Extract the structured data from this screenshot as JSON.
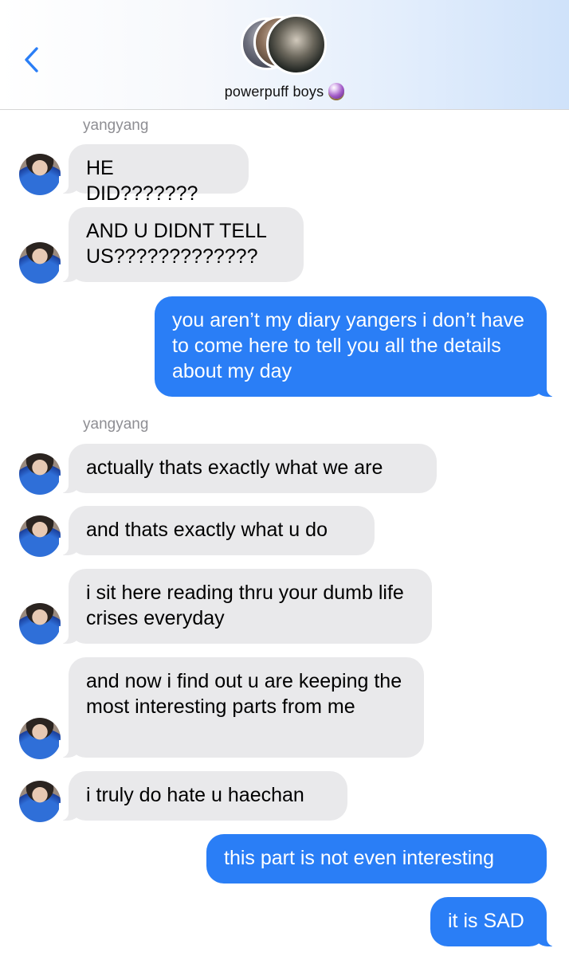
{
  "header": {
    "group_name": "powerpuff boys",
    "back_icon": "chevron-left-icon",
    "group_icon": "crystal-ball-icon",
    "accent_color": "#2a7ef6"
  },
  "messages": [
    {
      "sender": "yangyang",
      "direction": "incoming",
      "text": "HE DID???????"
    },
    {
      "sender": "yangyang",
      "direction": "incoming",
      "text": "AND U DIDNT TELL US?????????????"
    },
    {
      "sender": "me",
      "direction": "outgoing",
      "text": "you aren’t my diary yangers i don’t have to come here to tell you all the details about my day"
    },
    {
      "sender": "yangyang",
      "direction": "incoming",
      "text": "actually thats exactly what we are"
    },
    {
      "sender": "yangyang",
      "direction": "incoming",
      "text": "and thats exactly what u do"
    },
    {
      "sender": "yangyang",
      "direction": "incoming",
      "text": "i sit here reading thru your dumb life crises everyday"
    },
    {
      "sender": "yangyang",
      "direction": "incoming",
      "text": "and now i find out u are keeping the most interesting parts from me"
    },
    {
      "sender": "yangyang",
      "direction": "incoming",
      "text": "i truly do hate u haechan"
    },
    {
      "sender": "me",
      "direction": "outgoing",
      "text": "this part is not even interesting"
    },
    {
      "sender": "me",
      "direction": "outgoing",
      "text": "it is SAD"
    }
  ],
  "sender_labels": [
    "yangyang",
    "yangyang"
  ]
}
